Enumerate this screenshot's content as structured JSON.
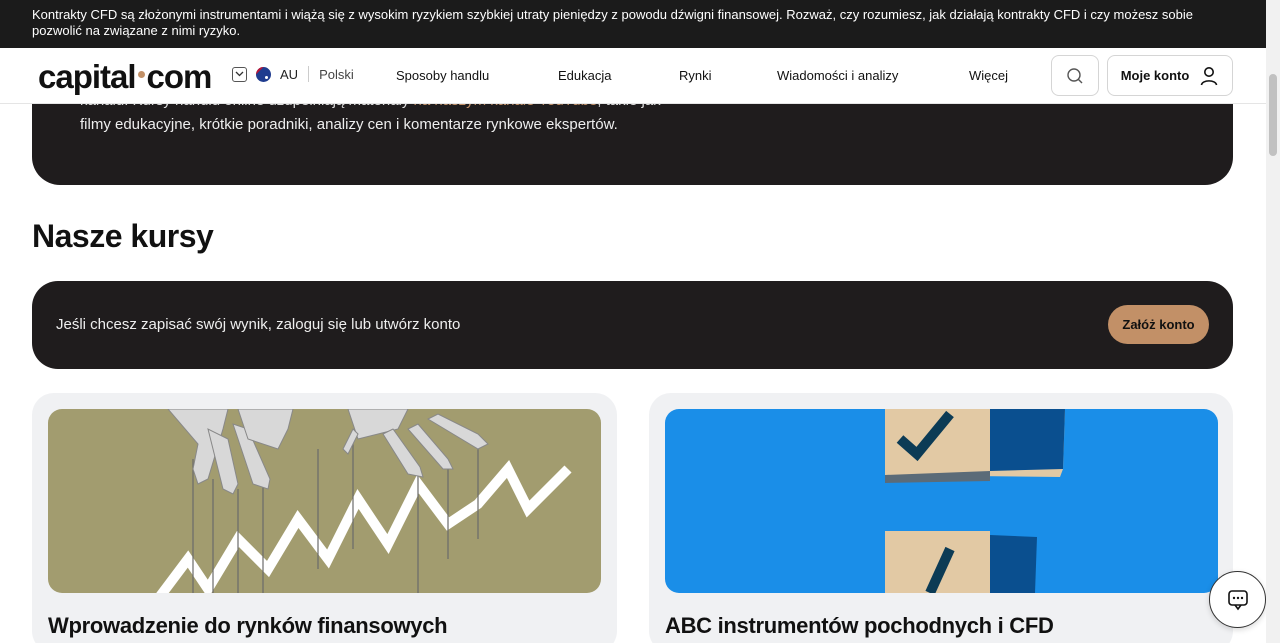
{
  "risk_banner": {
    "text": "Kontrakty CFD są złożonymi instrumentami i wiążą się z wysokim ryzykiem szybkiej utraty pieniędzy z powodu dźwigni finansowej. Rozważ, czy rozumiesz, jak działają kontrakty CFD i czy możesz sobie pozwolić na związane z nimi ryzyko."
  },
  "header": {
    "logo_left": "capital",
    "logo_right": "com",
    "region": "AU",
    "language": "Polski",
    "nav": [
      "Sposoby handlu",
      "Edukacja",
      "Rynki",
      "Wiadomości i analizy",
      "Więcej"
    ],
    "account_label": "Moje konto"
  },
  "hero": {
    "line1_text": "kanału. Kursy handlu online uzupełniają materiały",
    "line1_link": "na naszym kanale YouTube",
    "line1_tail": ", takie jak",
    "line2": "filmy edukacyjne, krótkie poradniki, analizy cen i komentarze rynkowe ekspertów."
  },
  "section_title": "Nasze kursy",
  "cta": {
    "text": "Jeśli chcesz zapisać swój wynik, zaloguj się lub utwórz konto",
    "button": "Załóż konto"
  },
  "courses": [
    {
      "title": "Wprowadzenie do rynków finansowych"
    },
    {
      "title": "ABC instrumentów pochodnych i CFD"
    }
  ],
  "colors": {
    "accent": "#c29067",
    "dark": "#1f1c1d",
    "banner": "#1b1b1b"
  },
  "icons": {
    "search": "search-icon",
    "user": "user-icon",
    "chat": "chat-icon",
    "chevron": "chevron-down-icon"
  }
}
